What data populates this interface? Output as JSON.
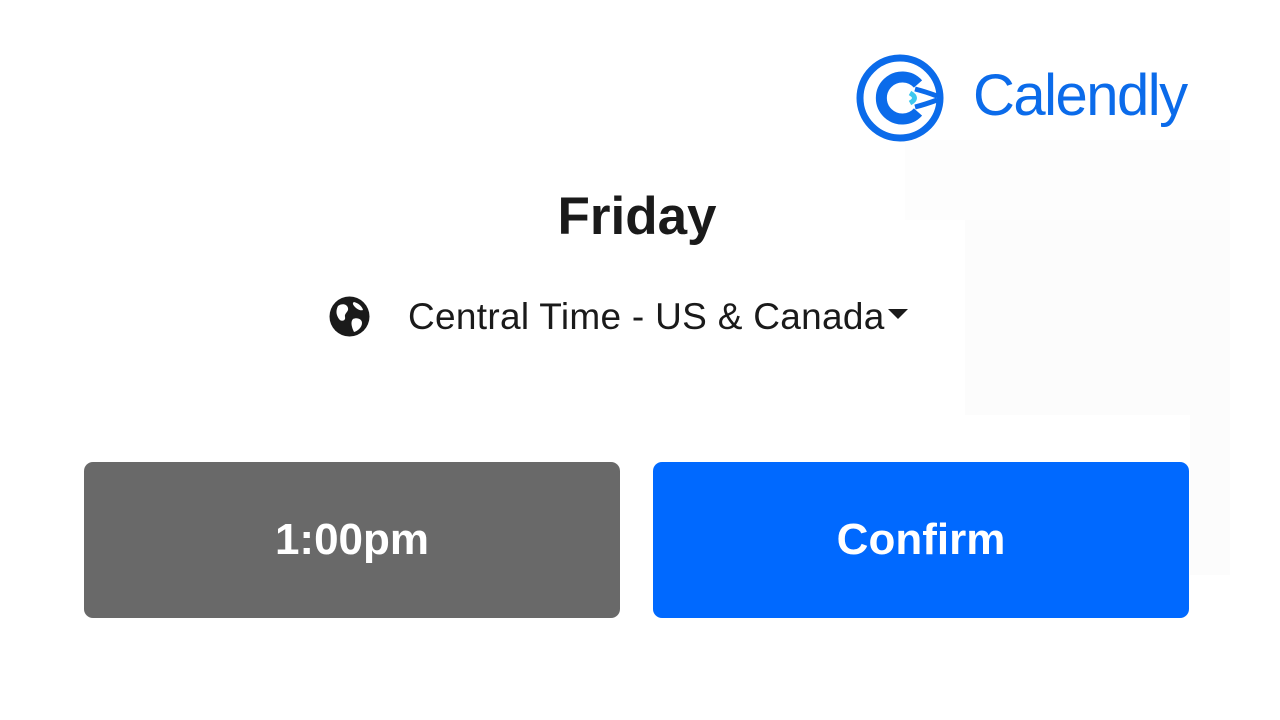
{
  "brand": {
    "name": "Calendly",
    "color": "#0b6bea",
    "logo_icon": "calendly-logo-icon"
  },
  "schedule": {
    "day": "Friday",
    "timezone_label": "Central Time - US & Canada",
    "timezone_icon": "globe-icon",
    "dropdown_icon": "caret-down-icon"
  },
  "actions": {
    "time_slot_label": "1:00pm",
    "confirm_label": "Confirm",
    "time_slot_color": "#696969",
    "confirm_color": "#0069ff"
  }
}
